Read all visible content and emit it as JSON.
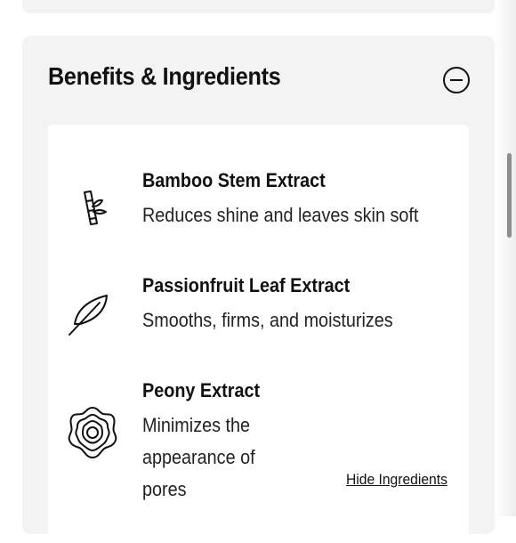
{
  "section": {
    "title": "Benefits & Ingredients",
    "collapse_icon": "minus-circle-icon"
  },
  "ingredients": [
    {
      "name": "Bamboo Stem Extract",
      "description": "Reduces shine and leaves skin soft",
      "icon": "bamboo-icon"
    },
    {
      "name": "Passionfruit Leaf Extract",
      "description": "Smooths, firms, and moisturizes",
      "icon": "leaf-icon"
    },
    {
      "name": "Peony Extract",
      "description": "Minimizes the appearance of pores",
      "icon": "peony-flower-icon"
    }
  ],
  "hide_link": "Hide Ingredients"
}
